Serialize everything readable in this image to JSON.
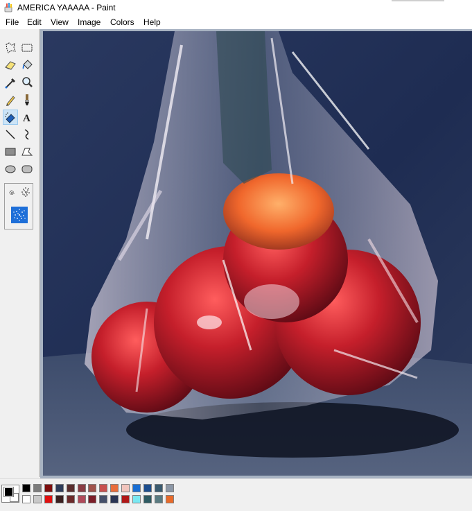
{
  "window": {
    "title": "AMERICA YAAAAA - Paint",
    "app_icon": "paint-icon"
  },
  "menu": [
    "File",
    "Edit",
    "View",
    "Image",
    "Colors",
    "Help"
  ],
  "tools": [
    {
      "name": "free-form-select-icon"
    },
    {
      "name": "select-icon"
    },
    {
      "name": "eraser-icon"
    },
    {
      "name": "fill-with-color-icon"
    },
    {
      "name": "pick-color-icon"
    },
    {
      "name": "magnifier-icon"
    },
    {
      "name": "pencil-icon"
    },
    {
      "name": "brush-icon"
    },
    {
      "name": "airbrush-icon",
      "selected": true
    },
    {
      "name": "text-icon"
    },
    {
      "name": "line-icon"
    },
    {
      "name": "curve-icon"
    },
    {
      "name": "rectangle-icon"
    },
    {
      "name": "polygon-icon"
    },
    {
      "name": "ellipse-icon"
    },
    {
      "name": "rounded-rectangle-icon"
    }
  ],
  "palette": {
    "foreground": "#000000",
    "background": "#ffffff",
    "colors_top": [
      "#000000",
      "#7b7b7b",
      "#7d0e0e",
      "#2e3c5a",
      "#5a2e2e",
      "#8a3c44",
      "#a0524b",
      "#c8504e",
      "#e96c3a",
      "#f2c5bd",
      "#1a6fd4",
      "#1d4e8e",
      "#3a5a6e",
      "#8c97a6"
    ],
    "colors_bottom": [
      "#ffffff",
      "#c8c8c8",
      "#e01010",
      "#3a2020",
      "#6b2a2a",
      "#b04a5a",
      "#7c1e28",
      "#45506a",
      "#2a3554",
      "#b01818",
      "#7ae8f2",
      "#2e5a62",
      "#5a7a80",
      "#e86a2a"
    ]
  }
}
